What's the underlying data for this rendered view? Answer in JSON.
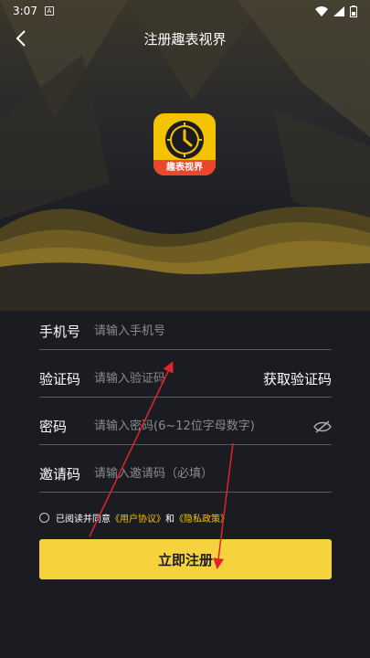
{
  "status_bar": {
    "time": "3:07",
    "notification_glyph": "A"
  },
  "header": {
    "title": "注册趣表视界"
  },
  "logo": {
    "label": "趣表视界"
  },
  "form": {
    "phone": {
      "label": "手机号",
      "placeholder": "请输入手机号"
    },
    "code": {
      "label": "验证码",
      "placeholder": "请输入验证码",
      "action": "获取验证码"
    },
    "password": {
      "label": "密码",
      "placeholder": "请输入密码(6~12位字母数字)"
    },
    "invite": {
      "label": "邀请码",
      "placeholder": "请输入邀请码（必填）"
    }
  },
  "agreement": {
    "prefix": "已阅读并同意",
    "user_agreement": "《用户协议》",
    "and": "和",
    "privacy": "《隐私政策》"
  },
  "submit_label": "立即注册",
  "colors": {
    "accent": "#f6d33c",
    "background": "#1b1c22",
    "annotation": "#e0242b",
    "logo_bg": "#f4c300",
    "logo_label_bg": "#e9472e"
  }
}
